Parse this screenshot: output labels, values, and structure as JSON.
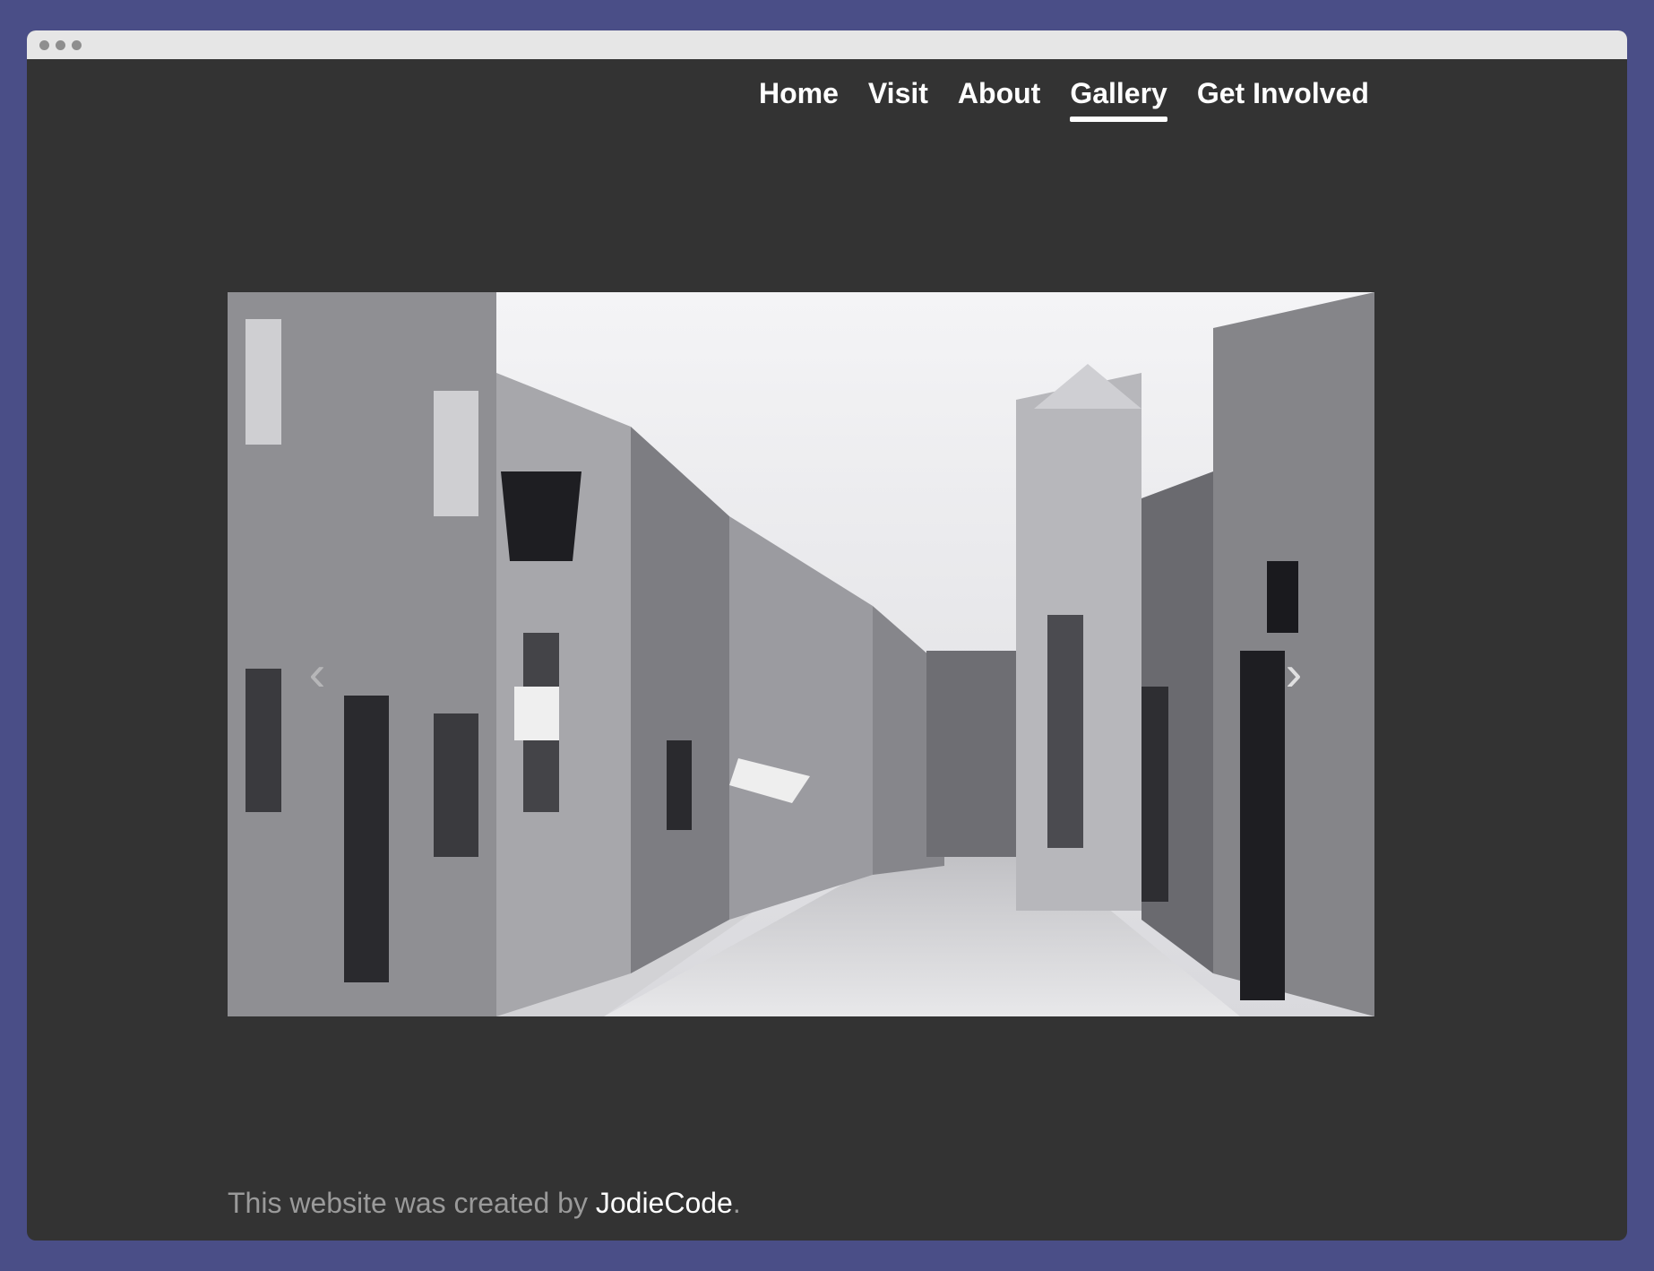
{
  "nav": {
    "items": [
      {
        "label": "Home",
        "active": false
      },
      {
        "label": "Visit",
        "active": false
      },
      {
        "label": "About",
        "active": false
      },
      {
        "label": "Gallery",
        "active": true
      },
      {
        "label": "Get Involved",
        "active": false
      }
    ]
  },
  "carousel": {
    "prev_icon": "chevron-left-icon",
    "next_icon": "chevron-right-icon",
    "prev_glyph": "‹",
    "next_glyph": "›"
  },
  "footer": {
    "prefix": "This website was created by ",
    "link": "JodieCode",
    "suffix": "."
  },
  "colors": {
    "background": "#4a4e87",
    "page": "#333333",
    "titlebar": "#e6e6e6",
    "nav_text": "#ffffff",
    "footer_text": "#9a9a9a"
  }
}
